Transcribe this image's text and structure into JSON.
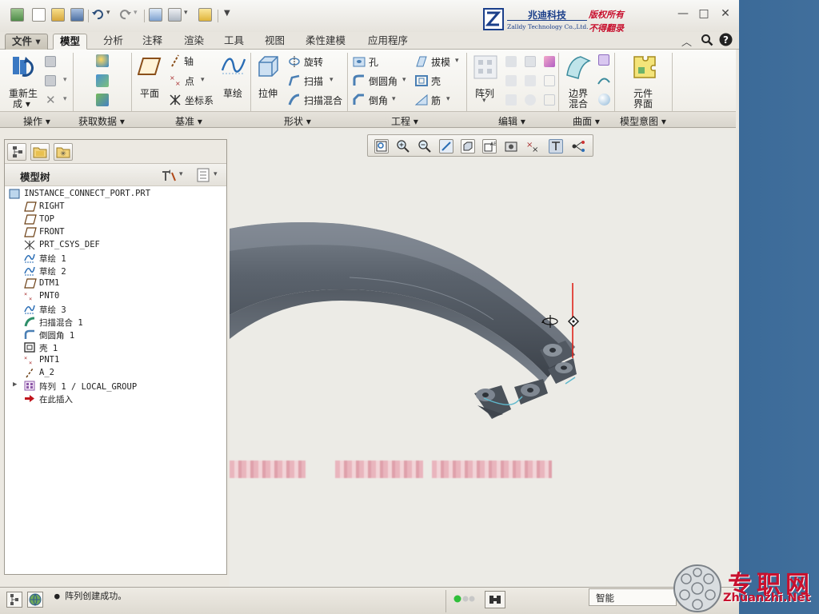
{
  "app": {
    "quick_access_count": 10
  },
  "logo": {
    "brand_cn": "兆迪科技",
    "brand_en": "Zalldy Technology Co.,Ltd.",
    "copyright_line1": "版权所有",
    "copyright_line2": "不得翻录"
  },
  "ribbon_tabs": [
    "文件 ▾",
    "模型",
    "分析",
    "注释",
    "渲染",
    "工具",
    "视图",
    "柔性建模",
    "应用程序"
  ],
  "ribbon": {
    "operations": {
      "regenerate": "重新生",
      "regenerate2": "成 ▾"
    },
    "datum": {
      "plane": "平面",
      "axis": "轴",
      "point": "点",
      "csys": "坐标系"
    },
    "sketch": "草绘",
    "shapes": {
      "extrude": "拉伸",
      "revolve": "旋转",
      "sweep": "扫描",
      "swept_blend": "扫描混合"
    },
    "engineering": {
      "hole": "孔",
      "round": "倒圆角",
      "chamfer": "倒角",
      "draft": "拔模",
      "shell": "壳",
      "rib": "筋"
    },
    "edit": {
      "pattern": "阵列"
    },
    "surface": {
      "boundary_line1": "边界",
      "boundary_line2": "混合"
    },
    "model_intent": {
      "component_line1": "元件",
      "component_line2": "界面"
    }
  },
  "group_labels": [
    "操作 ▾",
    "获取数据 ▾",
    "基准 ▾",
    "形状 ▾",
    "工程 ▾",
    "编辑 ▾",
    "曲面 ▾",
    "模型意图 ▾"
  ],
  "model_tree": {
    "title": "模型树",
    "items": [
      {
        "label": "INSTANCE_CONNECT_PORT.PRT",
        "icon": "part-icon",
        "indent": 0
      },
      {
        "label": "RIGHT",
        "icon": "datum-plane-icon",
        "indent": 1
      },
      {
        "label": "TOP",
        "icon": "datum-plane-icon",
        "indent": 1
      },
      {
        "label": "FRONT",
        "icon": "datum-plane-icon",
        "indent": 1
      },
      {
        "label": "PRT_CSYS_DEF",
        "icon": "csys-icon",
        "indent": 1
      },
      {
        "label": "草绘 1",
        "icon": "sketch-icon",
        "indent": 1
      },
      {
        "label": "草绘 2",
        "icon": "sketch-icon",
        "indent": 1
      },
      {
        "label": "DTM1",
        "icon": "datum-plane-icon",
        "indent": 1
      },
      {
        "label": "PNT0",
        "icon": "datum-point-icon",
        "indent": 1
      },
      {
        "label": "草绘 3",
        "icon": "sketch-icon",
        "indent": 1
      },
      {
        "label": "扫描混合 1",
        "icon": "swept-blend-icon",
        "indent": 1
      },
      {
        "label": "倒圆角 1",
        "icon": "round-icon",
        "indent": 1
      },
      {
        "label": "壳 1",
        "icon": "shell-icon",
        "indent": 1
      },
      {
        "label": "PNT1",
        "icon": "datum-point-icon",
        "indent": 1
      },
      {
        "label": "A_2",
        "icon": "datum-axis-icon",
        "indent": 1
      },
      {
        "label": "阵列 1 / LOCAL_GROUP",
        "icon": "pattern-icon",
        "indent": 1,
        "expandable": true
      },
      {
        "label": "在此插入",
        "icon": "insert-here-icon",
        "indent": 1
      }
    ]
  },
  "status": {
    "message": "● 阵列创建成功。",
    "filter": "智能"
  },
  "watermark": {
    "cn": "专职网",
    "en": "Zhuanzhi.Net"
  },
  "colors": {
    "ribbon_bg": "#f3f1ec",
    "desktop": "#3e6a96",
    "model_grey": "#5e6670",
    "watermark_red": "#c8102e"
  }
}
